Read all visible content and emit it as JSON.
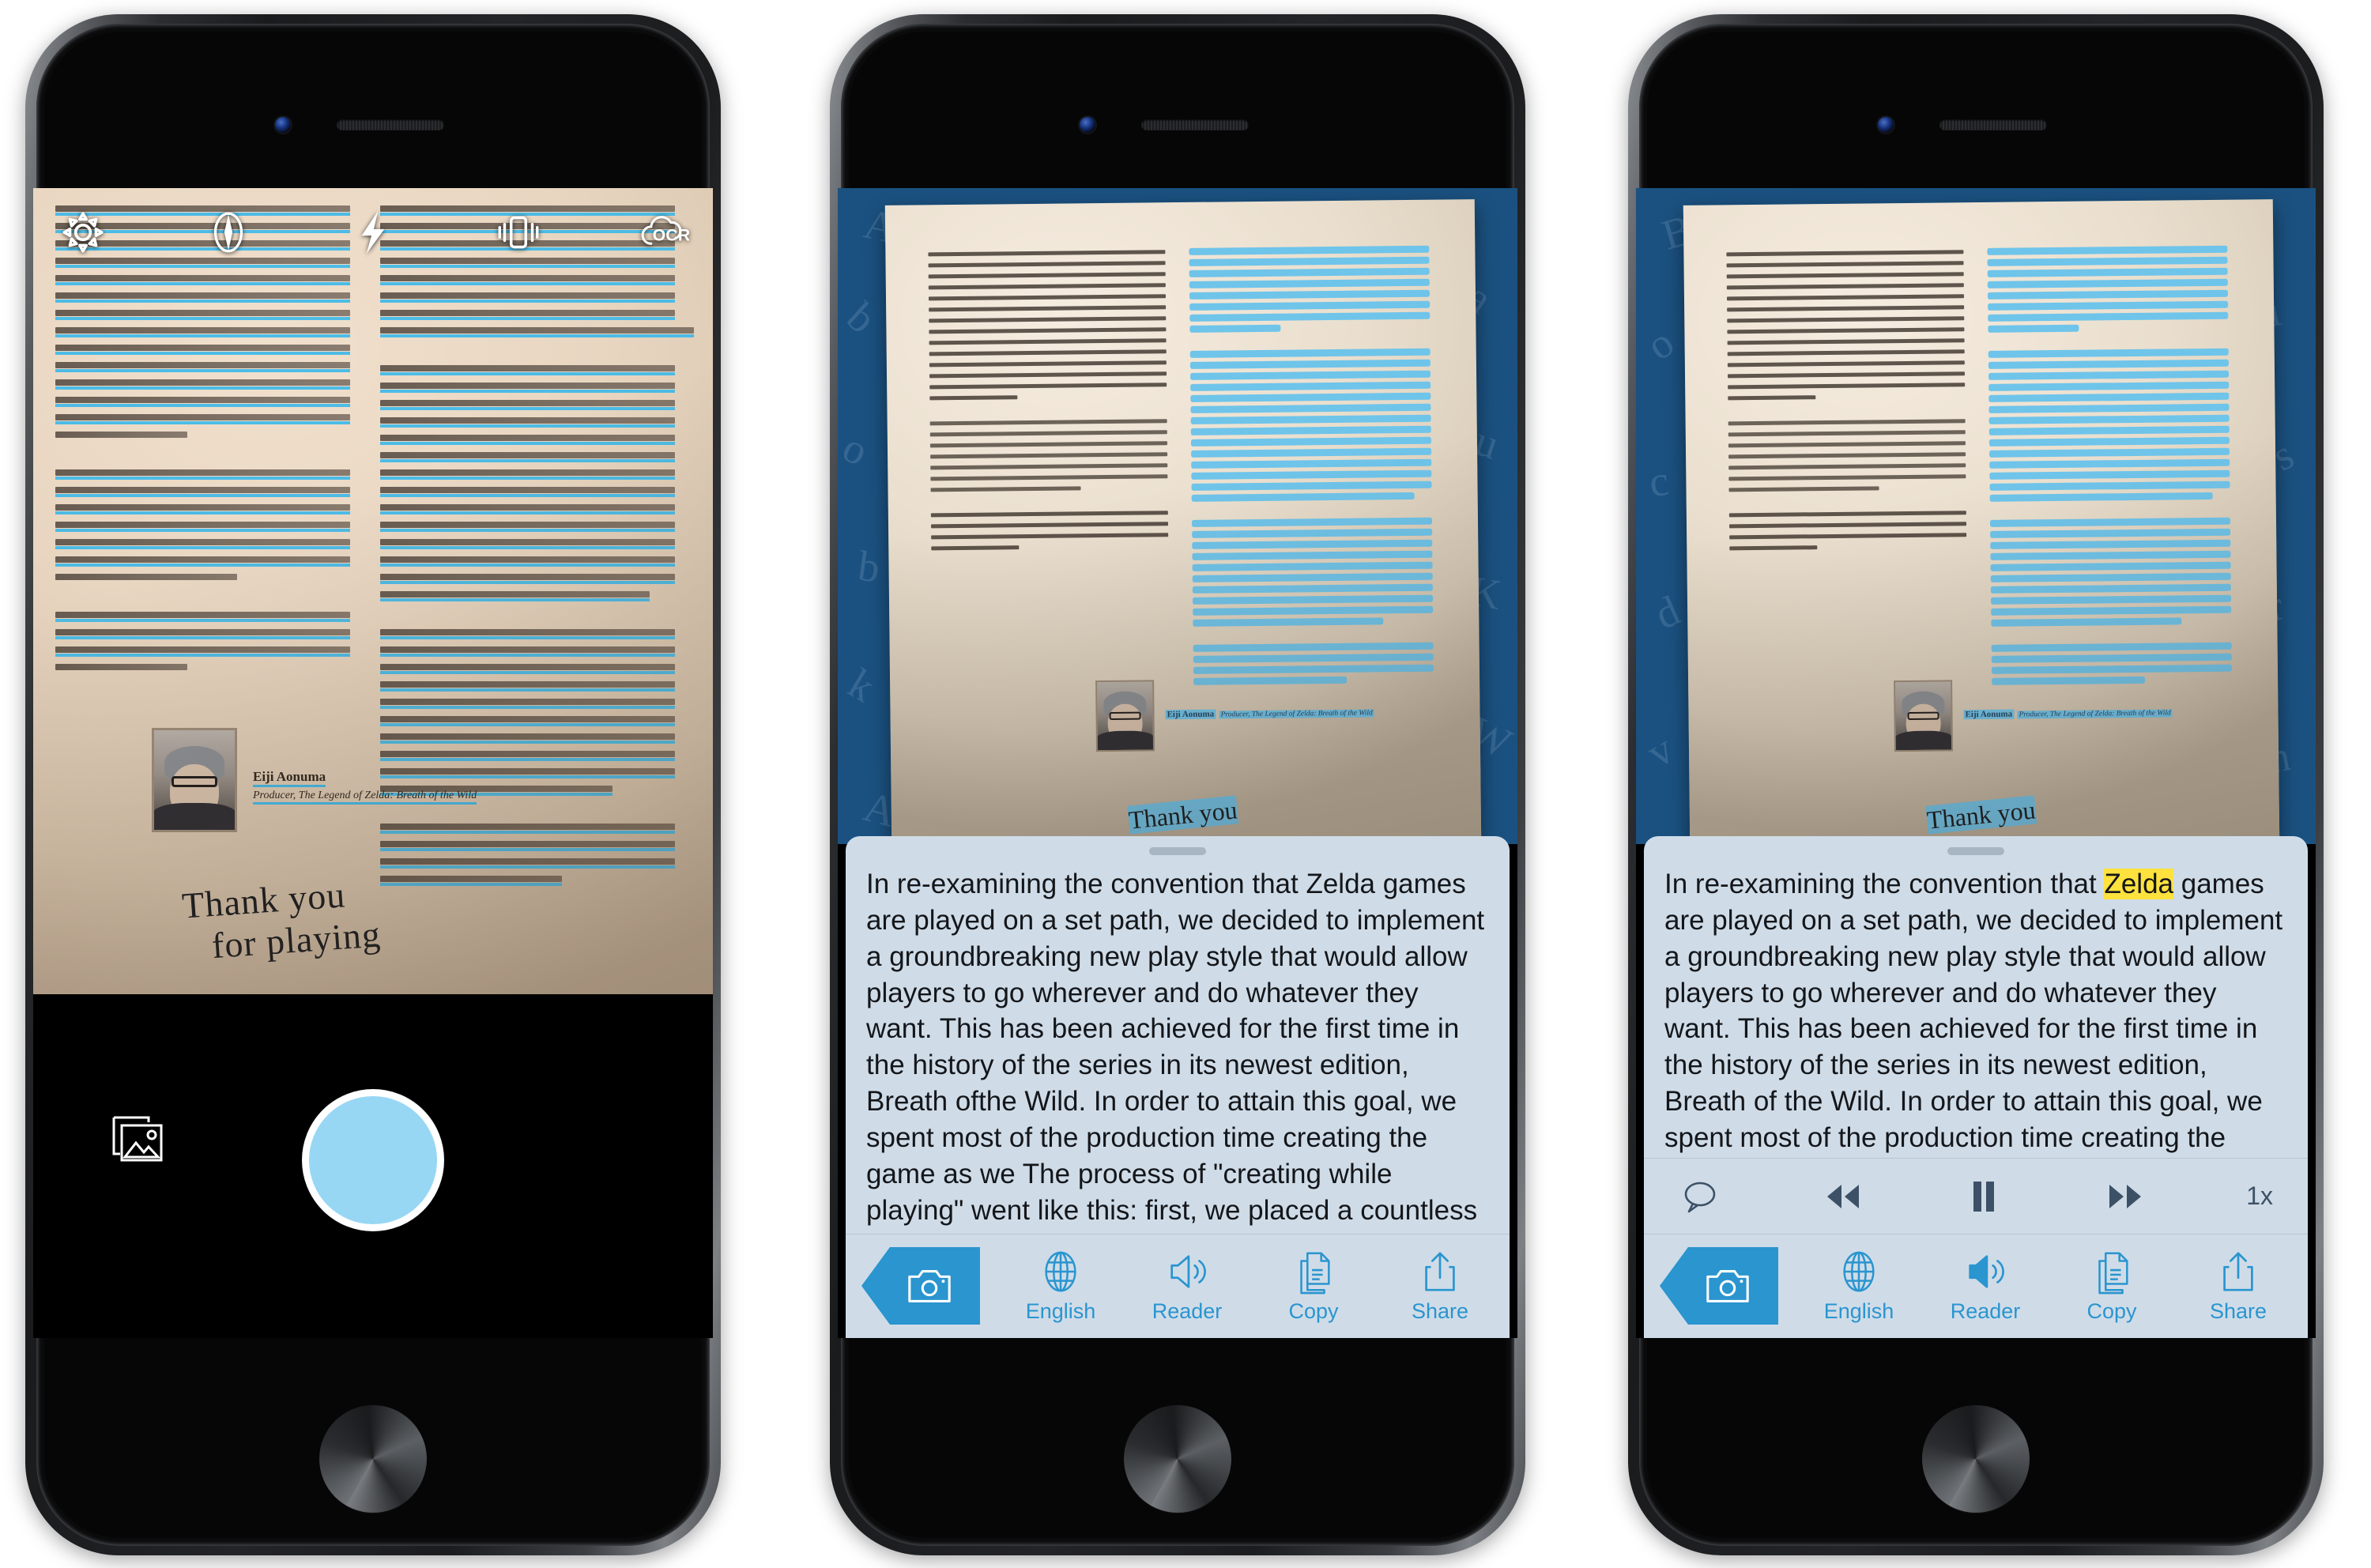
{
  "app": {
    "name": "OCR Scanner App",
    "accent_blue": "#2a95cf",
    "sheet_bg": "#cfdce8",
    "highlight_yellow": "#ffe23d",
    "shutter_blue": "#97d7f4",
    "photo_bg_blue": "#1b5180"
  },
  "phone1": {
    "screen_name": "camera-capture",
    "toolbar": [
      {
        "id": "settings",
        "icon": "gear-icon",
        "label": "Settings"
      },
      {
        "id": "compass",
        "icon": "compass-icon",
        "label": "Compass"
      },
      {
        "id": "flash",
        "icon": "flash-icon",
        "label": "Flash"
      },
      {
        "id": "vibrate",
        "icon": "vibrate-icon",
        "label": "Vibrate"
      },
      {
        "id": "ocr",
        "icon": "ocr-cloud-icon",
        "label": "OCR"
      }
    ],
    "gallery_button": {
      "icon": "gallery-icon",
      "label": "Gallery"
    },
    "shutter_button": {
      "icon": "shutter-icon",
      "label": "Capture"
    },
    "document": {
      "author_name": "Eiji Aonuma",
      "author_role": "Producer, The Legend of Zelda: Breath of the Wild",
      "handwriting_line1": "Thank you",
      "handwriting_line2": "for playing"
    }
  },
  "phone2": {
    "screen_name": "ocr-result",
    "document": {
      "author_name": "Eiji Aonuma",
      "author_role": "Producer, The Legend of Zelda: Breath of the Wild",
      "handwriting": "Thank you"
    },
    "recognized_text": "In re-examining the convention that Zelda games are played on a set path, we decided to implement a groundbreaking new play style that would allow players to go wherever and do whatever they want. This has been achieved for the first time in the history of the series in its newest edition, Breath ofthe Wild. In order to attain this goal, we spent most of the production time creating the game as we The process of \"creating while playing\" went like this: first, we placed a countless number of \"points\" throughout the vast world of Breath of the Wild. Then, as we went through and actually played the",
    "action_bar": {
      "camera_back": {
        "icon": "camera-icon",
        "label": "Back to camera"
      },
      "actions": [
        {
          "id": "language",
          "icon": "globe-icon",
          "label": "English"
        },
        {
          "id": "reader",
          "icon": "speaker-icon",
          "label": "Reader"
        },
        {
          "id": "copy",
          "icon": "copy-icon",
          "label": "Copy"
        },
        {
          "id": "share",
          "icon": "share-icon",
          "label": "Share"
        }
      ]
    }
  },
  "phone3": {
    "screen_name": "ocr-result-reading",
    "document": {
      "author_name": "Eiji Aonuma",
      "author_role": "Producer, The Legend of Zelda: Breath of the Wild",
      "handwriting": "Thank you"
    },
    "recognized_text_before": "In re-examining the convention that ",
    "recognized_text_highlight": "Zelda",
    "recognized_text_after": " games are played on a set path, we decided to implement a groundbreaking new play style that would allow players to go wherever and do whatever they want. This has been achieved for the first time in the history of the series in its newest edition, Breath of the Wild. In order to attain this goal, we spent most of the production time creating the game as we played it.\nThe process of \"creating while playing\" went like this:",
    "playback_bar": {
      "controls": [
        {
          "id": "speech",
          "icon": "speech-bubble-icon",
          "label": "Speech"
        },
        {
          "id": "rewind",
          "icon": "rewind-icon",
          "label": "Rewind"
        },
        {
          "id": "pause",
          "icon": "pause-icon",
          "label": "Pause"
        },
        {
          "id": "forward",
          "icon": "fast-forward-icon",
          "label": "Fast forward"
        }
      ],
      "rate": "1x"
    },
    "action_bar": {
      "camera_back": {
        "icon": "camera-icon",
        "label": "Back to camera"
      },
      "actions": [
        {
          "id": "language",
          "icon": "globe-icon",
          "label": "English"
        },
        {
          "id": "reader",
          "icon": "speaker-icon",
          "label": "Reader"
        },
        {
          "id": "copy",
          "icon": "copy-icon",
          "label": "Copy"
        },
        {
          "id": "share",
          "icon": "share-icon",
          "label": "Share"
        }
      ]
    }
  }
}
